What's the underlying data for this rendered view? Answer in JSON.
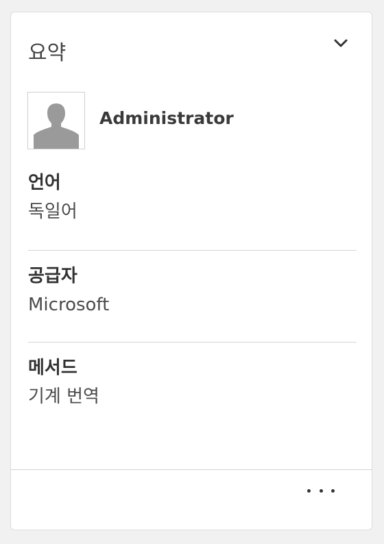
{
  "summary": {
    "title": "요약",
    "collapse_icon": "chevron-down-icon"
  },
  "user": {
    "name": "Administrator",
    "avatar_icon": "person-placeholder-icon"
  },
  "fields": [
    {
      "label": "언어",
      "value": "독일어"
    },
    {
      "label": "공급자",
      "value": "Microsoft"
    },
    {
      "label": "메서드",
      "value": "기계 번역"
    }
  ],
  "footer": {
    "more_icon": "more-horizontal-icon"
  },
  "colors": {
    "background": "#f1f1f1",
    "card": "#ffffff",
    "text": "#323232",
    "divider": "#d4d4d4"
  }
}
